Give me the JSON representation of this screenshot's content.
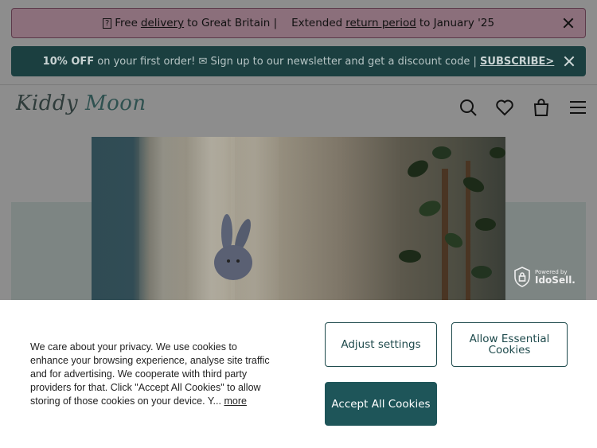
{
  "promo_bar": {
    "icon": "?",
    "text_free": "Free",
    "link_delivery": "delivery",
    "text_to_gb": "to Great Britain |",
    "text_extended": "Extended",
    "link_return": "return period",
    "text_to_jan": "to January '25"
  },
  "newsletter_bar": {
    "bold": "10% OFF",
    "text": "on your first order! ✉ Sign up to our newsletter and get a discount code |",
    "subscribe": "SUBSCRIBE>"
  },
  "header": {
    "logo_word1": "Kiddy",
    "logo_word2": "Moon"
  },
  "idosell": {
    "powered": "Powered by",
    "brand": "IdoSell."
  },
  "cookie": {
    "text": "We care about your privacy. We use cookies to enhance your browsing experience, analyse site traffic and for advertising. We cooperate with third party providers for that. Click \"Accept All Cookies\" to allow storing of those cookies on your device. Y...",
    "more": "more",
    "adjust": "Adjust settings",
    "essential": "Allow Essential Cookies",
    "accept": "Accept All Cookies"
  }
}
